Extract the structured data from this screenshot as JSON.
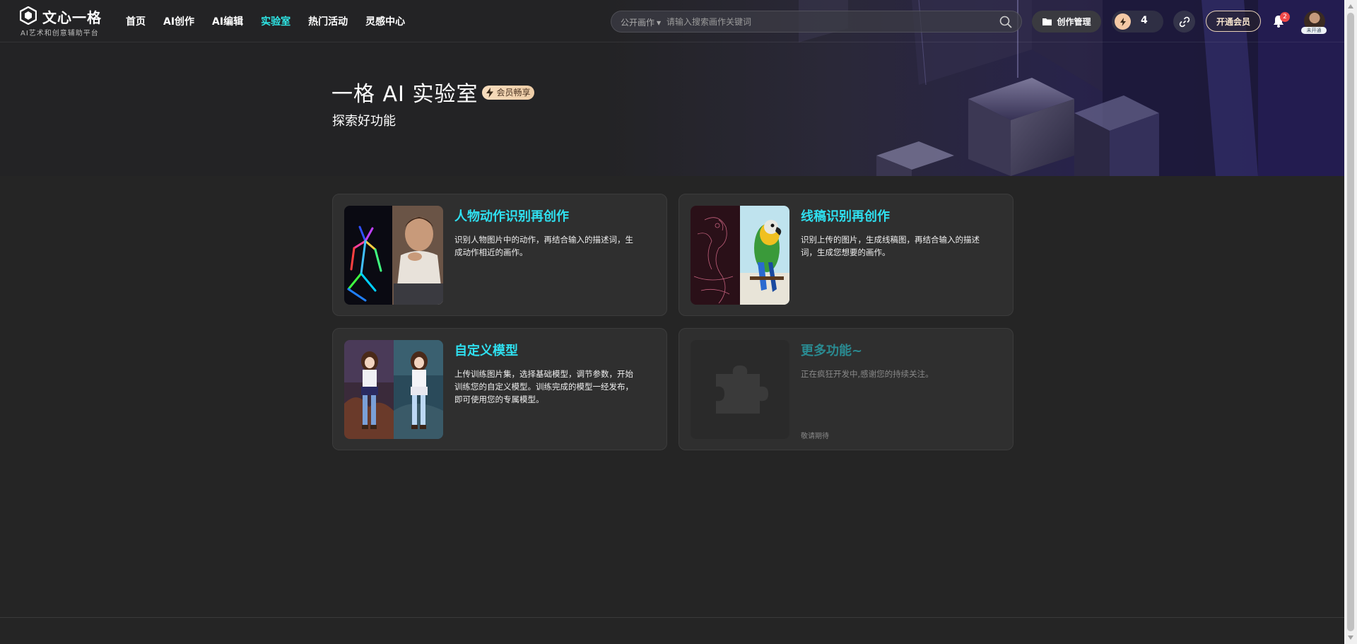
{
  "brand": {
    "title": "文心一格",
    "subtitle": "AI艺术和创意辅助平台"
  },
  "nav": [
    {
      "label": "首页",
      "active": false
    },
    {
      "label": "AI创作",
      "active": false
    },
    {
      "label": "AI编辑",
      "active": false
    },
    {
      "label": "实验室",
      "active": true
    },
    {
      "label": "热门活动",
      "active": false
    },
    {
      "label": "灵感中心",
      "active": false
    }
  ],
  "search": {
    "scope": "公开画作",
    "placeholder": "请输入搜索画作关键词"
  },
  "header_actions": {
    "manage_label": "创作管理",
    "energy_count": "4",
    "vip_label": "开通会员",
    "notification_count": "2",
    "avatar_tag": "未开通"
  },
  "hero": {
    "title": "一格 AI 实验室",
    "badge": "会员畅享",
    "subtitle": "探索好功能"
  },
  "cards": [
    {
      "title": "人物动作识别再创作",
      "desc": "识别人物图片中的动作，再结合输入的描述词，生成动作相近的画作。"
    },
    {
      "title": "线稿识别再创作",
      "desc": "识别上传的图片，生成线稿图，再结合输入的描述词，生成您想要的画作。"
    },
    {
      "title": "自定义模型",
      "desc": "上传训练图片集，选择基础模型，调节参数，开始训练您的自定义模型。训练完成的模型一经发布，即可使用您的专属模型。"
    },
    {
      "title": "更多功能~",
      "desc": "正在疯狂开发中,感谢您的持续关注。",
      "footer": "敬请期待"
    }
  ],
  "colors": {
    "accent": "#2ee6e6",
    "card_title": "#2fe0f0",
    "background": "#252525",
    "card_bg": "#2f2f2f"
  },
  "icons": [
    "logo-icon",
    "search-icon",
    "folder-icon",
    "lightning-icon",
    "link-icon",
    "bell-icon",
    "puzzle-icon"
  ]
}
